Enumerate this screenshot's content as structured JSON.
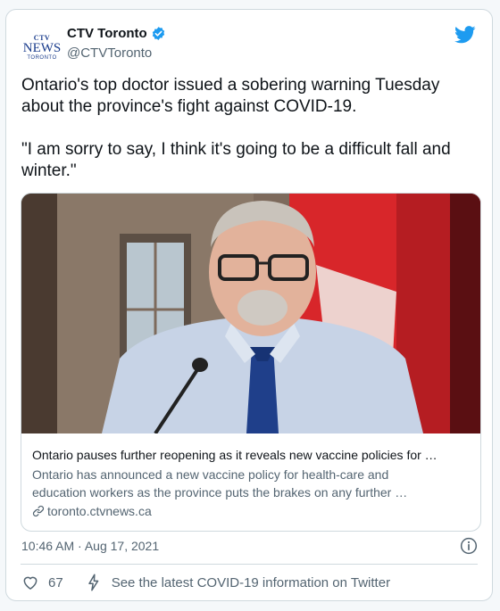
{
  "account": {
    "logo_line1": "CTV",
    "logo_line2": "NEWS",
    "logo_line3": "TORONTO",
    "name": "CTV Toronto",
    "handle": "@CTVToronto",
    "verified": true
  },
  "tweet": {
    "paragraphs": [
      "Ontario's top doctor issued a sobering warning Tuesday about the province's fight against COVID-19.",
      "\"I am sorry to say, I think it's going to be a difficult fall and winter.\""
    ],
    "timestamp": "10:46 AM · Aug 17, 2021",
    "like_count": "67",
    "covid_link": "See the latest COVID-19 information on Twitter"
  },
  "link_card": {
    "title": "Ontario pauses further reopening as it reveals new vaccine policies for …",
    "description_lines": [
      "Ontario has announced a new vaccine policy for health-care and",
      "education workers as the province puts the brakes on any further …"
    ],
    "domain": "toronto.ctvnews.ca"
  },
  "colors": {
    "brand_twitter": "#1d9bf0",
    "text_primary": "#0f1419",
    "text_secondary": "#536471",
    "border": "#cfd9de",
    "ctv_blue": "#1a3c8c"
  },
  "icons": [
    "ctv-news-logo",
    "verified-badge-icon",
    "twitter-bird-icon",
    "link-icon",
    "info-icon",
    "heart-icon",
    "lightning-icon"
  ]
}
